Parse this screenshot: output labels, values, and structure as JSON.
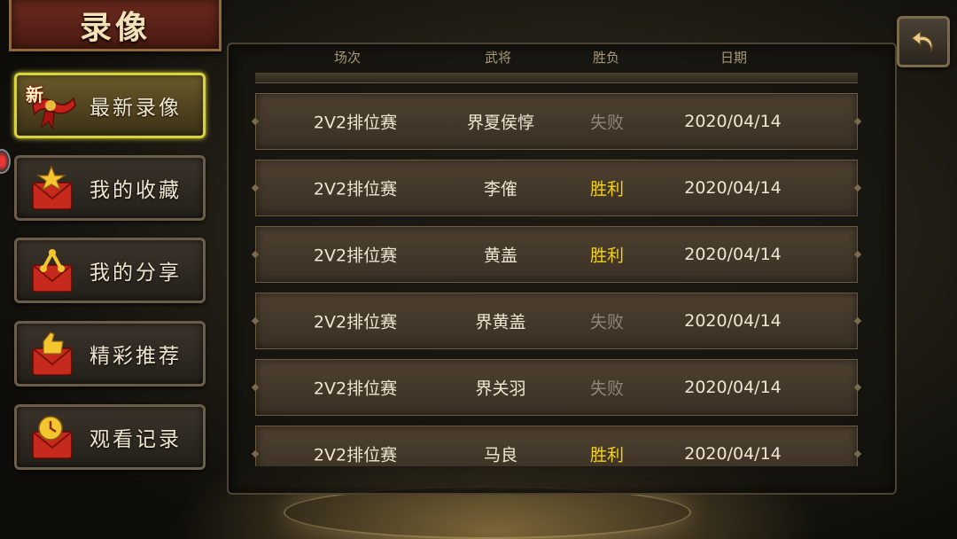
{
  "title": "录像",
  "back_icon": "back-arrow-icon",
  "menu": [
    {
      "label": "最新录像",
      "icon": "scroll-ribbon-icon",
      "badge": "新",
      "active": true
    },
    {
      "label": "我的收藏",
      "icon": "star-envelope-icon",
      "active": false
    },
    {
      "label": "我的分享",
      "icon": "share-envelope-icon",
      "active": false
    },
    {
      "label": "精彩推荐",
      "icon": "thumbsup-envelope-icon",
      "active": false
    },
    {
      "label": "观看记录",
      "icon": "clock-envelope-icon",
      "active": false
    }
  ],
  "table": {
    "headers": [
      "场次",
      "武将",
      "胜负",
      "日期"
    ],
    "rows": [
      {
        "match": "2V2排位赛",
        "general": "界夏侯惇",
        "result": "失败",
        "win": false,
        "date": "2020/04/14"
      },
      {
        "match": "2V2排位赛",
        "general": "李傕",
        "result": "胜利",
        "win": true,
        "date": "2020/04/14"
      },
      {
        "match": "2V2排位赛",
        "general": "黄盖",
        "result": "胜利",
        "win": true,
        "date": "2020/04/14"
      },
      {
        "match": "2V2排位赛",
        "general": "界黄盖",
        "result": "失败",
        "win": false,
        "date": "2020/04/14"
      },
      {
        "match": "2V2排位赛",
        "general": "界关羽",
        "result": "失败",
        "win": false,
        "date": "2020/04/14"
      },
      {
        "match": "2V2排位赛",
        "general": "马良",
        "result": "胜利",
        "win": true,
        "date": "2020/04/14"
      }
    ]
  },
  "colors": {
    "win": "#f2d21a",
    "lose": "#8e8676",
    "active_border": "#d9d23a"
  }
}
